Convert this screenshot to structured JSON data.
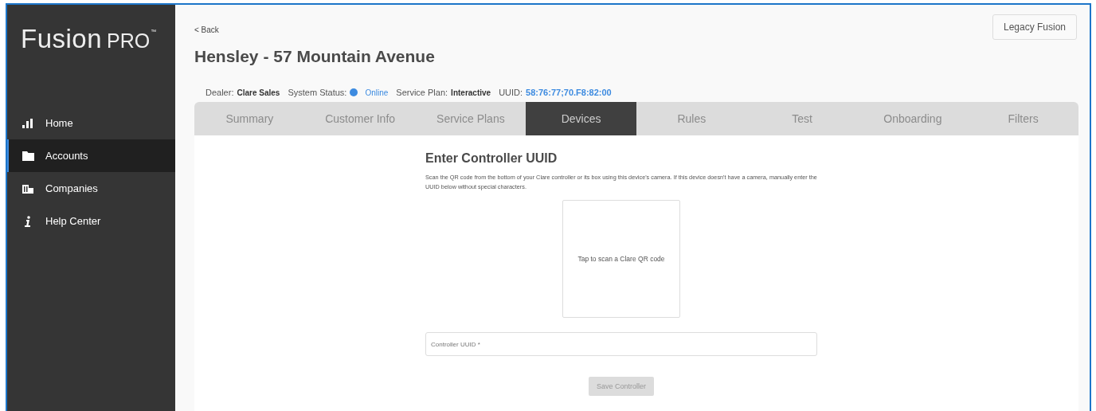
{
  "logo": {
    "name": "Fusion",
    "suffix": "PRO",
    "mark": "™"
  },
  "sidebar": {
    "items": [
      {
        "label": "Home",
        "kind": "chart",
        "selected": false
      },
      {
        "label": "Accounts",
        "kind": "folder",
        "selected": true
      },
      {
        "label": "Companies",
        "kind": "building",
        "selected": false
      },
      {
        "label": "Help Center",
        "kind": "info",
        "selected": false
      }
    ]
  },
  "back_link": "< Back",
  "legacy_button": "Legacy Fusion",
  "title": "Hensley - 57 Mountain Avenue",
  "info": [
    {
      "label": "Dealer:",
      "value": "Clare Sales",
      "kind": "plain"
    },
    {
      "label": "System Status:",
      "value": "Online",
      "kind": "status"
    },
    {
      "label": "Service Plan:",
      "value": "Interactive",
      "kind": "plain"
    },
    {
      "label": "UUID:",
      "value": "58:76:77;70.F8:82:00",
      "kind": "link"
    }
  ],
  "tabs": [
    {
      "label": "Summary",
      "selected": false
    },
    {
      "label": "Customer Info",
      "selected": false
    },
    {
      "label": "Service Plans",
      "selected": false
    },
    {
      "label": "Devices",
      "selected": true
    },
    {
      "label": "Rules",
      "selected": false
    },
    {
      "label": "Test",
      "selected": false
    },
    {
      "label": "Onboarding",
      "selected": false
    },
    {
      "label": "Filters",
      "selected": false
    }
  ],
  "form": {
    "heading": "Enter Controller UUID",
    "instructions": "Scan the QR code from the bottom of your Clare controller or its box using this device's camera. If this device doesn't have a camera, manually enter the UUID below without special characters.",
    "scan_area": "Tap to scan a Clare QR code",
    "uuid_field": {
      "placeholder": "Controller UUID *"
    },
    "save_button": {
      "label": "Save Controller",
      "disabled": true
    }
  }
}
